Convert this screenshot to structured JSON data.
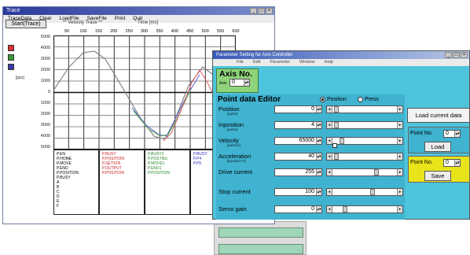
{
  "trace_window": {
    "title": "Trace",
    "menu": [
      "TraceData",
      "Clear",
      "LoadFile",
      "SaveFile",
      "Print",
      "Quit"
    ],
    "start_button": "Start(Trace)",
    "trace_header": "** Velocity Trace **",
    "time_label": "Time [ms]",
    "x_ticks": [
      "50",
      "100",
      "150",
      "200",
      "250",
      "300",
      "350",
      "400",
      "450",
      "500",
      "550",
      "600"
    ],
    "y_ticks": [
      "5000",
      "4000",
      "3000",
      "2000",
      "1000",
      "0",
      "1000",
      "2000",
      "3000",
      "4000",
      "5000"
    ],
    "channel_colors": [
      "#d83030",
      "#3a9a3a",
      "#3a3aa8"
    ],
    "legend_col1": [
      "P.EN",
      "P.HOME",
      "P.MOVE",
      "P.END",
      "P.POSITION",
      "P.BUSY",
      "A",
      "B",
      "C",
      "D",
      "E",
      "F"
    ],
    "legend_col2": [
      "P.BUSY",
      "P.POSITION",
      "P.SETSTA",
      "P.OUTPUT",
      "P.POSITION"
    ],
    "legend_col3": [
      "P.BUSY2",
      "P.POSTNG",
      "P.MOVE1",
      "P.END1",
      "P.POSITION"
    ],
    "legend_col4": [
      "P.BUSY",
      "P.P4",
      "P.P5"
    ]
  },
  "editor_window": {
    "title": "Parameter Setting for Axis Controller",
    "menu": [
      "File",
      "Edit",
      "Parameter",
      "Window",
      "Help"
    ],
    "axis_no_label": "Axis No.",
    "axis_sub": "Axis",
    "axis_value": "0",
    "point_data_title": "Point data Editor",
    "mode_position": "Position",
    "mode_press": "Press",
    "fields": [
      {
        "label": "Position",
        "sub": "[pulse]",
        "value": "0"
      },
      {
        "label": "Inposition",
        "sub": "[pulse]",
        "value": "4"
      },
      {
        "label": "Velocity",
        "sub": "[pulse/s]",
        "value": "65000"
      },
      {
        "label": "Acceleration",
        "sub": "[kpulse/s^2]",
        "value": "40"
      },
      {
        "label": "Drive current",
        "sub": "",
        "value": "255"
      },
      {
        "label": "Stop current",
        "sub": "",
        "value": "100"
      },
      {
        "label": "Servo gain",
        "sub": "",
        "value": "0"
      }
    ],
    "load_current_data": "Load current data",
    "load_box": {
      "label": "Point No.",
      "value": "0",
      "button": "Load"
    },
    "save_box": {
      "label": "Point No.",
      "value": "0",
      "button": "Save"
    }
  }
}
